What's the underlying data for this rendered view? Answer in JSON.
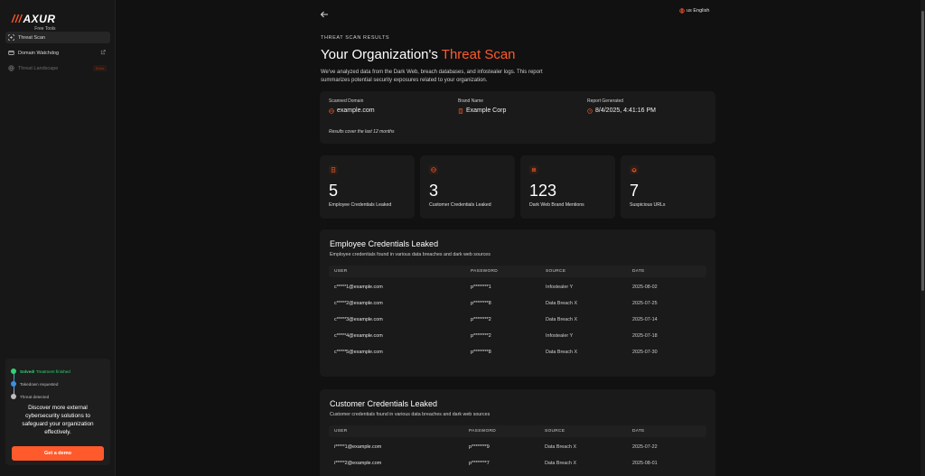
{
  "brand": {
    "name": "AXUR",
    "slashes": "///",
    "subtitle": "Free Tools"
  },
  "sidebar": {
    "items": [
      {
        "label": "Threat Scan",
        "icon": "crosshair-icon",
        "active": true
      },
      {
        "label": "Domain Watchdog",
        "icon": "globe-icon",
        "external": true
      },
      {
        "label": "Threat Landscape",
        "icon": "globe-icon",
        "disabled": true,
        "badge": "Soon"
      }
    ],
    "promo": {
      "timeline": [
        {
          "strong": "Solved!",
          "text": "Treatment finished",
          "color": "#2ed573"
        },
        {
          "text": "Takedown requested",
          "color": "#3b8ee6"
        },
        {
          "text": "Threat detected",
          "color": "#bdbdbd"
        }
      ],
      "text": "Discover more external cybersecurity solutions to safeguard your organization effectively.",
      "button": "Get a demo"
    }
  },
  "header": {
    "language": "us English"
  },
  "page": {
    "eyebrow": "THREAT SCAN RESULTS",
    "title_prefix": "Your Organization's",
    "title_accent": "Threat Scan",
    "description": "We've analyzed data from the Dark Web, breach databases, and infostealer logs. This report summarizes potential security exposures related to your organization."
  },
  "info": {
    "domain_label": "Scanned Domain",
    "domain_value": "example.com",
    "brand_label": "Brand Name",
    "brand_value": "Example Corp",
    "report_label": "Report Generated",
    "report_value": "8/4/2025, 4:41:16 PM",
    "note": "Results cover the last 12 months"
  },
  "stats": [
    {
      "value": "5",
      "label": "Employee Credentials Leaked",
      "icon": "id-card-icon"
    },
    {
      "value": "3",
      "label": "Customer Credentials Leaked",
      "icon": "user-circle-icon"
    },
    {
      "value": "123",
      "label": "Dark Web Brand Mentions",
      "icon": "incognito-icon"
    },
    {
      "value": "7",
      "label": "Suspicious URLs",
      "icon": "phishing-hook-icon"
    }
  ],
  "employee_table": {
    "title": "Employee Credentials Leaked",
    "subtitle": "Employee credentials found in various data breaches and dark web sources",
    "headers": [
      "USER",
      "PASSWORD",
      "SOURCE",
      "DATE"
    ],
    "rows": [
      [
        "c*****1@example.com",
        "p********1",
        "Infostealer Y",
        "2025-08-02"
      ],
      [
        "c*****2@example.com",
        "p********8",
        "Data Breach X",
        "2025-07-25"
      ],
      [
        "c*****3@example.com",
        "p********2",
        "Data Breach X",
        "2025-07-14"
      ],
      [
        "c*****4@example.com",
        "p********2",
        "Infostealer Y",
        "2025-07-18"
      ],
      [
        "c*****5@example.com",
        "p********8",
        "Data Breach X",
        "2025-07-30"
      ]
    ]
  },
  "customer_table": {
    "title": "Customer Credentials Leaked",
    "subtitle": "Customer credentials found in various data breaches and dark web sources",
    "headers": [
      "USER",
      "PASSWORD",
      "SOURCE",
      "DATE"
    ],
    "rows": [
      [
        "i*****1@example.com",
        "p********9",
        "Data Breach X",
        "2025-07-22"
      ],
      [
        "i*****2@example.com",
        "p********7",
        "Data Breach X",
        "2025-08-01"
      ]
    ]
  },
  "colors": {
    "accent": "#ff5a2c",
    "success": "#2ed573",
    "info": "#3b8ee6",
    "background": "#111111",
    "card": "#1a1a1a"
  }
}
